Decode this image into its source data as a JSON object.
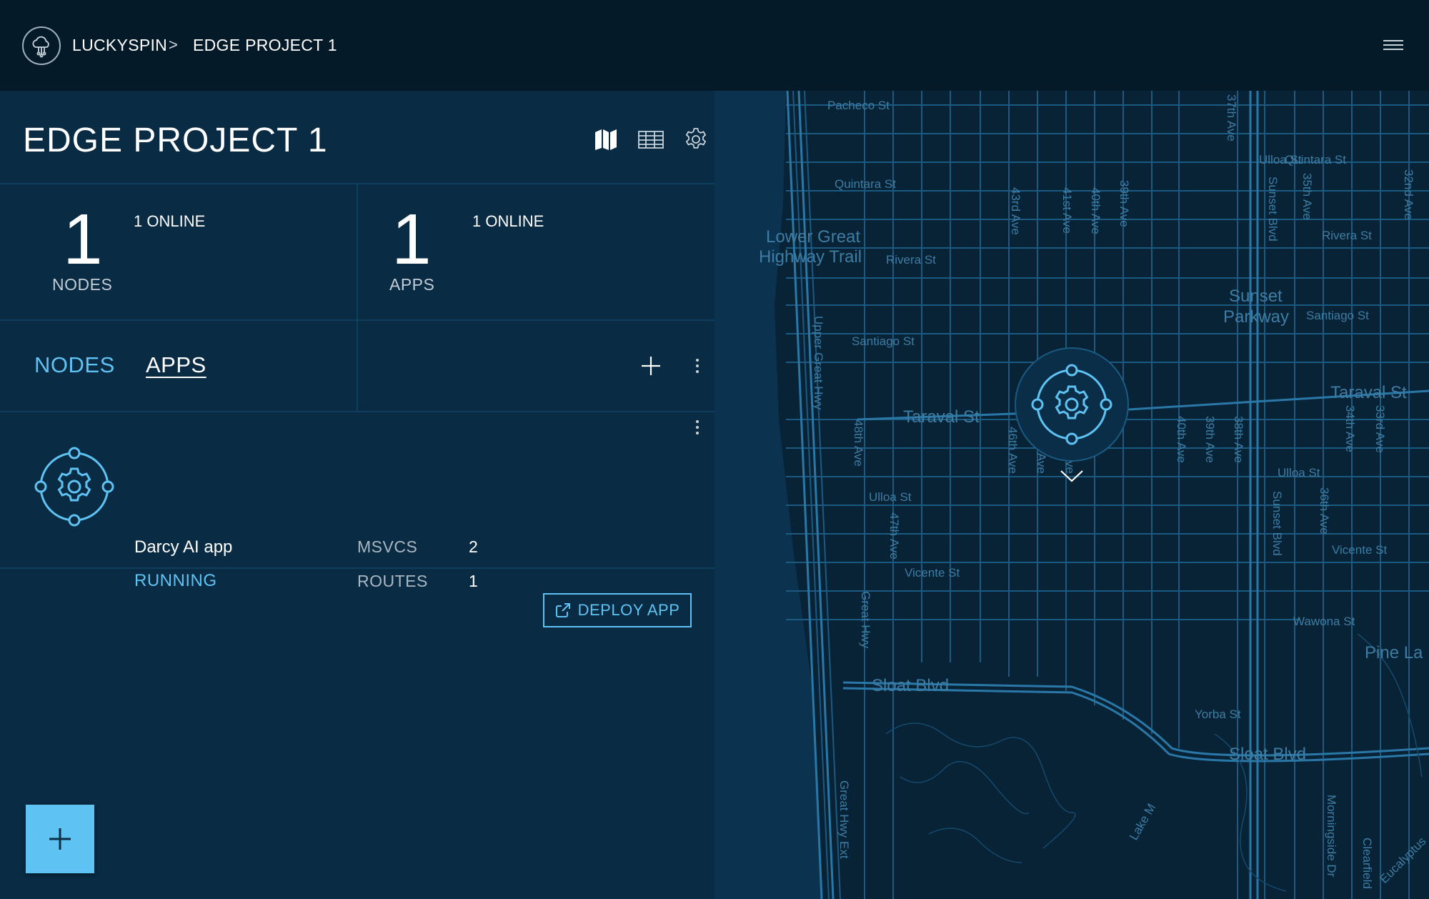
{
  "header": {
    "org_name": "LUCKYSPIN",
    "breadcrumb_separator": ">",
    "project_name": "EDGE PROJECT 1",
    "logo_icon": "cloud-network-icon",
    "menu_icon": "hamburger-menu-icon"
  },
  "project": {
    "title": "EDGE PROJECT 1",
    "view_icons": [
      "map-icon",
      "table-icon",
      "gear-icon"
    ]
  },
  "stats": [
    {
      "count": "1",
      "online": "1 ONLINE",
      "label": "NODES"
    },
    {
      "count": "1",
      "online": "1 ONLINE",
      "label": "APPS"
    }
  ],
  "tabs": {
    "nodes_label": "NODES",
    "apps_label": "APPS",
    "active": "APPS"
  },
  "apps": [
    {
      "name": "Darcy AI app",
      "status": "RUNNING",
      "msvcs_label": "MSVCS",
      "msvcs_value": "2",
      "routes_label": "ROUTES",
      "routes_value": "1"
    }
  ],
  "actions": {
    "deploy_label": "DEPLOY APP",
    "fab_icon": "plus-icon"
  },
  "map": {
    "street_labels": [
      "Pacheco St",
      "Quintara St",
      "Lower Great",
      "Highway Trail",
      "Rivera St",
      "Santiago St",
      "Taraval St",
      "Ulloa St",
      "Vicente St",
      "Sloat Blvd",
      "Sunset",
      "Parkway",
      "Pine La",
      "Yorba St",
      "Wawona St",
      "43rd Ave",
      "41st Ave",
      "40th Ave",
      "39th Ave",
      "37th Ave",
      "35th Ave",
      "34th Ave",
      "33rd Ave",
      "32nd Ave",
      "38th Ave",
      "36th Ave",
      "45th Ave",
      "46th Ave",
      "47th Ave",
      "48th Ave",
      "44th Ave",
      "Sunset Blvd",
      "Great Hwy",
      "Upper Great Hwy",
      "Great Hwy Ext",
      "Morningside Dr",
      "Clearfield",
      "Eucalyptus",
      "Lake M"
    ],
    "colors": {
      "water": "#0b3350",
      "land": "#082236",
      "streets": "#1c5a82",
      "major": "#2a78a8"
    }
  }
}
